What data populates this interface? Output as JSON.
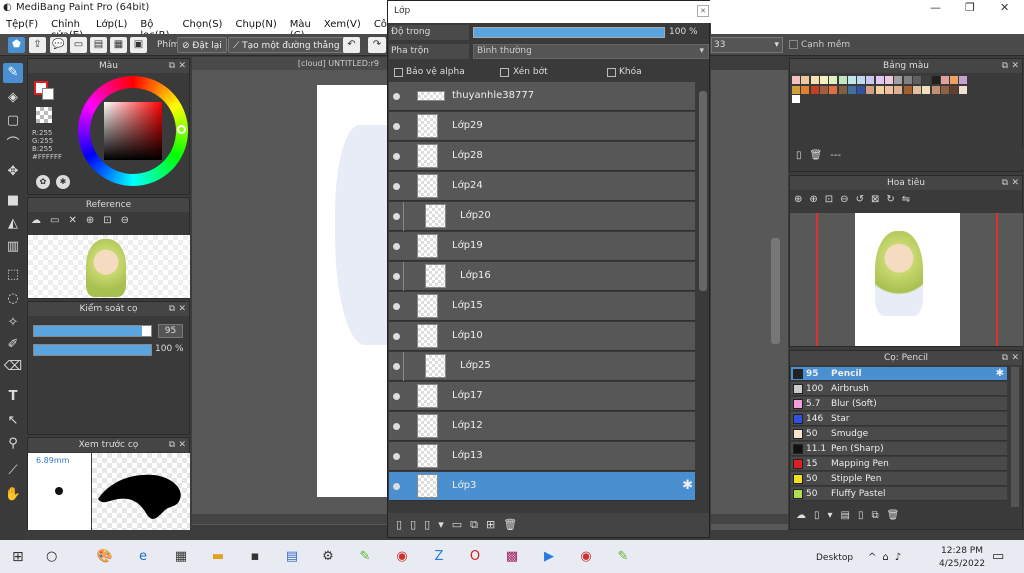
{
  "app": {
    "title": "MediBang Paint Pro (64bit)",
    "win_min": "—",
    "win_max": "❐",
    "win_close": "✕"
  },
  "menu": [
    "Tệp(F)",
    "Chỉnh sửa(E)",
    "Lớp(L)",
    "Bộ lọc(R)",
    "Chọn(S)",
    "Chụp(N)",
    "Màu (C)",
    "Xem(V)",
    "Côn"
  ],
  "toolbar": {
    "snap_label": "Phím",
    "reset_label": "Đặt lại",
    "straight_label": "Tạo một đường thẳng",
    "size_value": "33",
    "aa_label": "Cạnh mềm"
  },
  "color_panel": {
    "title": "Màu",
    "r": "R:255",
    "g": "G:255",
    "b": "B:255",
    "hex": "#FFFFFF"
  },
  "reference_panel": {
    "title": "Reference"
  },
  "brush_control": {
    "title": "Kiểm soát cọ",
    "size": "95",
    "opacity": "100 %",
    "size_frac": 0.92,
    "opacity_frac": 1.0
  },
  "brush_preview": {
    "title": "Xem trước cọ",
    "size_label": "6.89mm"
  },
  "canvas": {
    "tab_title": "[cloud] UNTITLED:r9"
  },
  "layer_window": {
    "title": "Lớp",
    "opacity_label": "Độ trong",
    "opacity_value": "100 %",
    "blend_label": "Pha trộn",
    "blend_value": "Bình thường",
    "protect_alpha": "Bảo vệ alpha",
    "clipping": "Xén bớt",
    "lock": "Khóa",
    "layers": [
      {
        "name": "thuyanhle38777",
        "indent": 0,
        "selected": false
      },
      {
        "name": "Lớp29",
        "indent": 0,
        "selected": false
      },
      {
        "name": "Lớp28",
        "indent": 0,
        "selected": false
      },
      {
        "name": "Lớp24",
        "indent": 0,
        "selected": false
      },
      {
        "name": "Lớp20",
        "indent": 1,
        "selected": false
      },
      {
        "name": "Lớp19",
        "indent": 0,
        "selected": false
      },
      {
        "name": "Lớp16",
        "indent": 1,
        "selected": false
      },
      {
        "name": "Lớp15",
        "indent": 0,
        "selected": false
      },
      {
        "name": "Lớp10",
        "indent": 0,
        "selected": false
      },
      {
        "name": "Lớp25",
        "indent": 1,
        "selected": false
      },
      {
        "name": "Lớp17",
        "indent": 0,
        "selected": false
      },
      {
        "name": "Lớp12",
        "indent": 0,
        "selected": false
      },
      {
        "name": "Lớp13",
        "indent": 0,
        "selected": false
      },
      {
        "name": "Lớp3",
        "indent": 0,
        "selected": true
      }
    ]
  },
  "palette_panel": {
    "title": "Bảng màu",
    "empty": "---"
  },
  "navigator_panel": {
    "title": "Hoa tiêu"
  },
  "brush_panel": {
    "title": "Cọ: Pencil",
    "brushes": [
      {
        "value": "95",
        "name": "Pencil",
        "color": "#222222",
        "selected": true
      },
      {
        "value": "100",
        "name": "Airbrush",
        "color": "#cccccc",
        "selected": false
      },
      {
        "value": "5.7",
        "name": "Blur (Soft)",
        "color": "#f0a0d8",
        "selected": false
      },
      {
        "value": "146",
        "name": "Star",
        "color": "#3050e0",
        "selected": false
      },
      {
        "value": "50",
        "name": "Smudge",
        "color": "#f5e6d0",
        "selected": false
      },
      {
        "value": "11.1",
        "name": "Pen (Sharp)",
        "color": "#111111",
        "selected": false
      },
      {
        "value": "15",
        "name": "Mapping Pen",
        "color": "#e02020",
        "selected": false
      },
      {
        "value": "50",
        "name": "Stipple Pen",
        "color": "#f0e020",
        "selected": false
      },
      {
        "value": "50",
        "name": "Fluffy Pastel",
        "color": "#b0e050",
        "selected": false
      }
    ]
  },
  "taskbar": {
    "desktop": "Desktop",
    "time": "12:28 PM",
    "date": "4/25/2022"
  }
}
